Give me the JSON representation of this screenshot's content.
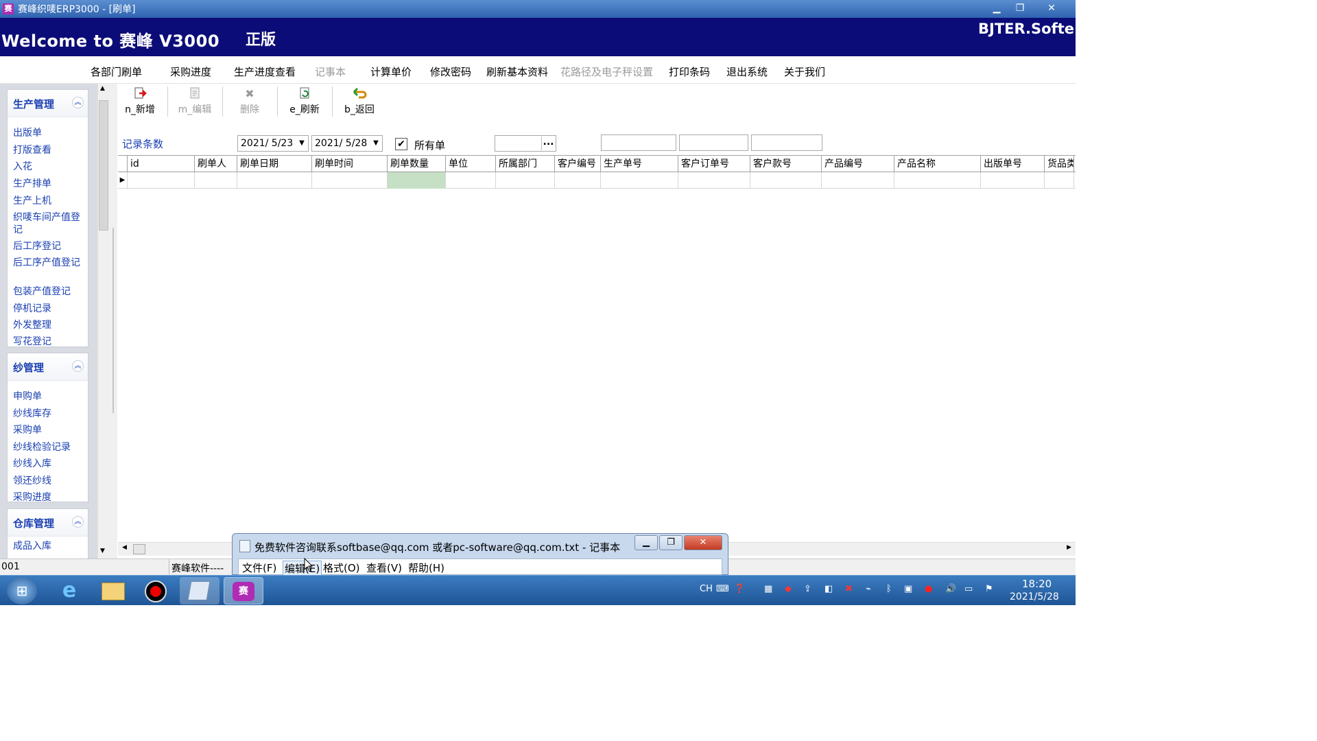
{
  "window": {
    "title": "赛峰织唛ERP3000 - [刷单]",
    "app_icon": "赛"
  },
  "banner": {
    "welcome": "Welcome to 赛峰 V3000",
    "edition": "正版",
    "brand": "BJTER.Softe"
  },
  "menu": {
    "items": [
      "各部门刷单",
      "采购进度",
      "生产进度查看",
      "记事本",
      "计算单价",
      "修改密码",
      "刷新基本资料",
      "花路径及电子秤设置",
      "打印条码",
      "退出系统",
      "关于我们"
    ]
  },
  "sidebar": {
    "groups": [
      {
        "title": "生产管理",
        "items": [
          "出版单",
          "打版查看",
          "入花",
          "生产排单",
          "生产上机",
          "织唛车间产值登记",
          "后工序登记",
          "后工序产值登记",
          "包装产值登记",
          "停机记录",
          "外发整理",
          "写花登记"
        ]
      },
      {
        "title": "纱管理",
        "items": [
          "申购单",
          "纱线库存",
          "采购单",
          "纱线检验记录",
          "纱线入库",
          "领还纱线",
          "采购进度"
        ]
      },
      {
        "title": "仓库管理",
        "items": [
          "成品入库"
        ]
      }
    ]
  },
  "toolbar": {
    "add": "n_新增",
    "edit": "m_编辑",
    "delete": "删除",
    "refresh": "e_刷新",
    "back": "b_返回"
  },
  "filter": {
    "record_count_label": "记录条数",
    "date_from": "2021/ 5/23",
    "date_to": "2021/ 5/28",
    "all_orders_label": "所有单",
    "all_orders_checked": true,
    "ellipsis": "..."
  },
  "grid": {
    "columns": [
      "id",
      "刷单人",
      "刷单日期",
      "刷单时间",
      "刷单数量",
      "单位",
      "所属部门",
      "客户编号",
      "生产单号",
      "客户订单号",
      "客户款号",
      "产品编号",
      "产品名称",
      "出版单号",
      "货品类"
    ]
  },
  "status": {
    "left": "001",
    "mid": "赛峰软件----"
  },
  "notepad": {
    "title": "免费软件咨询联系softbase@qq.com 或者pc-software@qq.com.txt - 记事本",
    "menu": [
      "文件(F)",
      "编辑(E)",
      "格式(O)",
      "查看(V)",
      "帮助(H)"
    ]
  },
  "tray": {
    "lang": "CH",
    "time": "18:20",
    "date": "2021/5/28"
  },
  "colors": {
    "title_bar": "#2f63b0",
    "banner": "#0c0c78",
    "link_blue": "#1a3fb1",
    "selected_cell": "#c6e0c6"
  }
}
